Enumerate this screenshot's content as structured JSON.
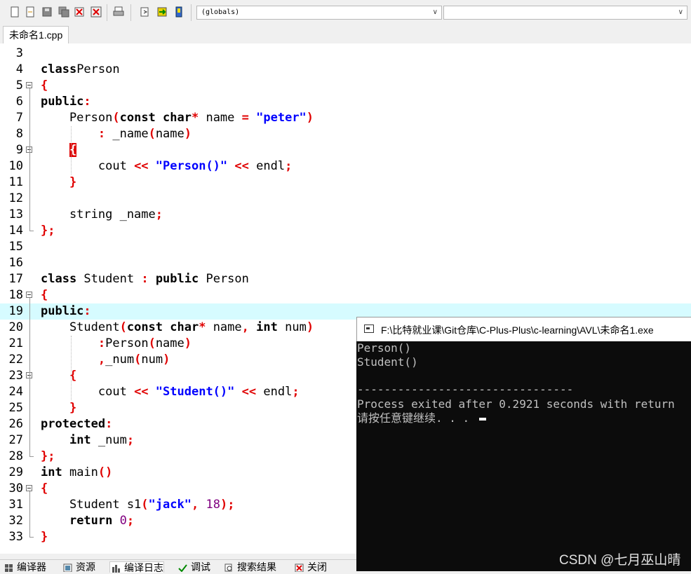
{
  "toolbar": {
    "scope_combo": "(globals)",
    "func_combo": ""
  },
  "tab": {
    "label": "未命名1.cpp"
  },
  "editor": {
    "lines": [
      {
        "n": "3"
      },
      {
        "n": "4"
      },
      {
        "n": "5"
      },
      {
        "n": "6"
      },
      {
        "n": "7"
      },
      {
        "n": "8"
      },
      {
        "n": "9"
      },
      {
        "n": "10"
      },
      {
        "n": "11"
      },
      {
        "n": "12"
      },
      {
        "n": "13"
      },
      {
        "n": "14"
      },
      {
        "n": "15"
      },
      {
        "n": "16"
      },
      {
        "n": "17"
      },
      {
        "n": "18"
      },
      {
        "n": "19"
      },
      {
        "n": "20"
      },
      {
        "n": "21"
      },
      {
        "n": "22"
      },
      {
        "n": "23"
      },
      {
        "n": "24"
      },
      {
        "n": "25"
      },
      {
        "n": "26"
      },
      {
        "n": "27"
      },
      {
        "n": "28"
      },
      {
        "n": "29"
      },
      {
        "n": "30"
      },
      {
        "n": "31"
      },
      {
        "n": "32"
      },
      {
        "n": "33"
      }
    ],
    "code": {
      "l4": [
        [
          "kw",
          "class"
        ],
        [
          "",
          "Person"
        ]
      ],
      "l5": [
        [
          "sym",
          "{"
        ]
      ],
      "l6": [
        [
          "kw",
          "public"
        ],
        [
          "sym",
          ":"
        ]
      ],
      "l7": [
        [
          "",
          "    Person"
        ],
        [
          "sym",
          "("
        ],
        [
          "kw",
          "const char"
        ],
        [
          "sym",
          "*"
        ],
        [
          "",
          " name "
        ],
        [
          "sym",
          "="
        ],
        [
          "",
          " "
        ],
        [
          "str",
          "\"peter\""
        ],
        [
          "sym",
          ")"
        ]
      ],
      "l8": [
        [
          "",
          "        "
        ],
        [
          "sym",
          ":"
        ],
        [
          "",
          " _name"
        ],
        [
          "sym",
          "("
        ],
        [
          "",
          "name"
        ],
        [
          "sym",
          ")"
        ]
      ],
      "l9": [
        [
          "",
          "    "
        ],
        [
          "brk",
          "{"
        ]
      ],
      "l10": [
        [
          "",
          "        cout "
        ],
        [
          "sym",
          "<<"
        ],
        [
          "",
          " "
        ],
        [
          "str",
          "\"Person()\""
        ],
        [
          "",
          " "
        ],
        [
          "sym",
          "<<"
        ],
        [
          "",
          " endl"
        ],
        [
          "sym",
          ";"
        ]
      ],
      "l11": [
        [
          "",
          "    "
        ],
        [
          "sym",
          "}"
        ]
      ],
      "l13": [
        [
          "",
          "    string _name"
        ],
        [
          "sym",
          ";"
        ]
      ],
      "l14": [
        [
          "sym",
          "};"
        ]
      ],
      "l17": [
        [
          "kw",
          "class"
        ],
        [
          "",
          " Student "
        ],
        [
          "sym",
          ":"
        ],
        [
          "",
          " "
        ],
        [
          "kw",
          "public"
        ],
        [
          "",
          " Person"
        ]
      ],
      "l18": [
        [
          "sym",
          "{"
        ]
      ],
      "l19": [
        [
          "kw",
          "public"
        ],
        [
          "sym",
          ":"
        ]
      ],
      "l20": [
        [
          "",
          "    Student"
        ],
        [
          "sym",
          "("
        ],
        [
          "kw",
          "const char"
        ],
        [
          "sym",
          "*"
        ],
        [
          "",
          " name"
        ],
        [
          "sym",
          ","
        ],
        [
          "",
          " "
        ],
        [
          "kw",
          "int"
        ],
        [
          "",
          " num"
        ],
        [
          "sym",
          ")"
        ]
      ],
      "l21": [
        [
          "",
          "        "
        ],
        [
          "sym",
          ":"
        ],
        [
          "",
          "Person"
        ],
        [
          "sym",
          "("
        ],
        [
          "",
          "name"
        ],
        [
          "sym",
          ")"
        ]
      ],
      "l22": [
        [
          "",
          "        "
        ],
        [
          "sym",
          ","
        ],
        [
          "",
          "_num"
        ],
        [
          "sym",
          "("
        ],
        [
          "",
          "num"
        ],
        [
          "sym",
          ")"
        ]
      ],
      "l23": [
        [
          "",
          "    "
        ],
        [
          "sym",
          "{"
        ]
      ],
      "l24": [
        [
          "",
          "        cout "
        ],
        [
          "sym",
          "<<"
        ],
        [
          "",
          " "
        ],
        [
          "str",
          "\"Student()\""
        ],
        [
          "",
          " "
        ],
        [
          "sym",
          "<<"
        ],
        [
          "",
          " endl"
        ],
        [
          "sym",
          ";"
        ]
      ],
      "l25": [
        [
          "",
          "    "
        ],
        [
          "sym",
          "}"
        ]
      ],
      "l26": [
        [
          "kw",
          "protected"
        ],
        [
          "sym",
          ":"
        ]
      ],
      "l27": [
        [
          "",
          "    "
        ],
        [
          "kw",
          "int"
        ],
        [
          "",
          " _num"
        ],
        [
          "sym",
          ";"
        ]
      ],
      "l28": [
        [
          "sym",
          "};"
        ]
      ],
      "l29": [
        [
          "kw",
          "int"
        ],
        [
          "",
          " main"
        ],
        [
          "sym",
          "()"
        ]
      ],
      "l30": [
        [
          "sym",
          "{"
        ]
      ],
      "l31": [
        [
          "",
          "    Student s1"
        ],
        [
          "sym",
          "("
        ],
        [
          "str",
          "\"jack\""
        ],
        [
          "sym",
          ","
        ],
        [
          "",
          " "
        ],
        [
          "num",
          "18"
        ],
        [
          "sym",
          ");"
        ]
      ],
      "l32": [
        [
          "",
          "    "
        ],
        [
          "kw",
          "return"
        ],
        [
          "",
          " "
        ],
        [
          "num",
          "0"
        ],
        [
          "sym",
          ";"
        ]
      ],
      "l33": [
        [
          "sym",
          "}"
        ]
      ]
    }
  },
  "console": {
    "title": "F:\\比特就业课\\Git仓库\\C-Plus-Plus\\c-learning\\AVL\\未命名1.exe",
    "lines": [
      "Person()",
      "Student()",
      "",
      "--------------------------------",
      "Process exited after 0.2921 seconds with return",
      "请按任意键继续. . . "
    ]
  },
  "bottom_tabs": [
    "编译器",
    "资源",
    "编译日志",
    "调试",
    "搜索结果",
    "关闭"
  ],
  "watermark": "CSDN @七月巫山晴",
  "colors": {
    "keyword_symbol": "#e00000",
    "string": "#0000ff",
    "number": "#800080",
    "highlight_line": "#d6fbff",
    "console_bg": "#0c0c0c"
  }
}
